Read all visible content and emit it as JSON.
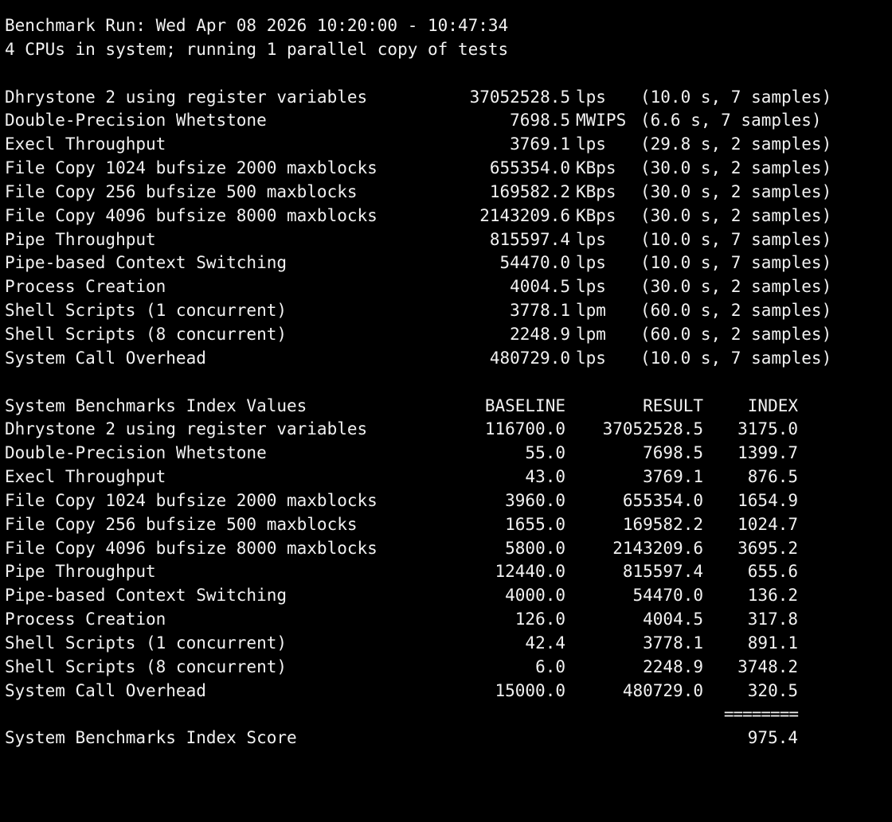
{
  "header": {
    "run_line": "Benchmark Run: Wed Apr 08 2026 10:20:00 - 10:47:34",
    "cpu_line": "4 CPUs in system; running 1 parallel copy of tests"
  },
  "results": [
    {
      "name": "Dhrystone 2 using register variables",
      "value": "37052528.5",
      "unit": "lps",
      "detail": "(10.0 s, 7 samples)"
    },
    {
      "name": "Double-Precision Whetstone",
      "value": "7698.5",
      "unit": "MWIPS",
      "detail": "(6.6 s, 7 samples)"
    },
    {
      "name": "Execl Throughput",
      "value": "3769.1",
      "unit": "lps",
      "detail": "(29.8 s, 2 samples)"
    },
    {
      "name": "File Copy 1024 bufsize 2000 maxblocks",
      "value": "655354.0",
      "unit": "KBps",
      "detail": "(30.0 s, 2 samples)"
    },
    {
      "name": "File Copy 256 bufsize 500 maxblocks",
      "value": "169582.2",
      "unit": "KBps",
      "detail": "(30.0 s, 2 samples)"
    },
    {
      "name": "File Copy 4096 bufsize 8000 maxblocks",
      "value": "2143209.6",
      "unit": "KBps",
      "detail": "(30.0 s, 2 samples)"
    },
    {
      "name": "Pipe Throughput",
      "value": "815597.4",
      "unit": "lps",
      "detail": "(10.0 s, 7 samples)"
    },
    {
      "name": "Pipe-based Context Switching",
      "value": "54470.0",
      "unit": "lps",
      "detail": "(10.0 s, 7 samples)"
    },
    {
      "name": "Process Creation",
      "value": "4004.5",
      "unit": "lps",
      "detail": "(30.0 s, 2 samples)"
    },
    {
      "name": "Shell Scripts (1 concurrent)",
      "value": "3778.1",
      "unit": "lpm",
      "detail": "(60.0 s, 2 samples)"
    },
    {
      "name": "Shell Scripts (8 concurrent)",
      "value": "2248.9",
      "unit": "lpm",
      "detail": "(60.0 s, 2 samples)"
    },
    {
      "name": "System Call Overhead",
      "value": "480729.0",
      "unit": "lps",
      "detail": "(10.0 s, 7 samples)"
    }
  ],
  "index_table": {
    "title": "System Benchmarks Index Values",
    "col_baseline": "BASELINE",
    "col_result": "RESULT",
    "col_index": "INDEX",
    "rows": [
      {
        "name": "Dhrystone 2 using register variables",
        "baseline": "116700.0",
        "result": "37052528.5",
        "index": "3175.0"
      },
      {
        "name": "Double-Precision Whetstone",
        "baseline": "55.0",
        "result": "7698.5",
        "index": "1399.7"
      },
      {
        "name": "Execl Throughput",
        "baseline": "43.0",
        "result": "3769.1",
        "index": "876.5"
      },
      {
        "name": "File Copy 1024 bufsize 2000 maxblocks",
        "baseline": "3960.0",
        "result": "655354.0",
        "index": "1654.9"
      },
      {
        "name": "File Copy 256 bufsize 500 maxblocks",
        "baseline": "1655.0",
        "result": "169582.2",
        "index": "1024.7"
      },
      {
        "name": "File Copy 4096 bufsize 8000 maxblocks",
        "baseline": "5800.0",
        "result": "2143209.6",
        "index": "3695.2"
      },
      {
        "name": "Pipe Throughput",
        "baseline": "12440.0",
        "result": "815597.4",
        "index": "655.6"
      },
      {
        "name": "Pipe-based Context Switching",
        "baseline": "4000.0",
        "result": "54470.0",
        "index": "136.2"
      },
      {
        "name": "Process Creation",
        "baseline": "126.0",
        "result": "4004.5",
        "index": "317.8"
      },
      {
        "name": "Shell Scripts (1 concurrent)",
        "baseline": "42.4",
        "result": "3778.1",
        "index": "891.1"
      },
      {
        "name": "Shell Scripts (8 concurrent)",
        "baseline": "6.0",
        "result": "2248.9",
        "index": "3748.2"
      },
      {
        "name": "System Call Overhead",
        "baseline": "15000.0",
        "result": "480729.0",
        "index": "320.5"
      }
    ],
    "separator": "========",
    "score_label": "System Benchmarks Index Score",
    "score_value": "975.4"
  }
}
